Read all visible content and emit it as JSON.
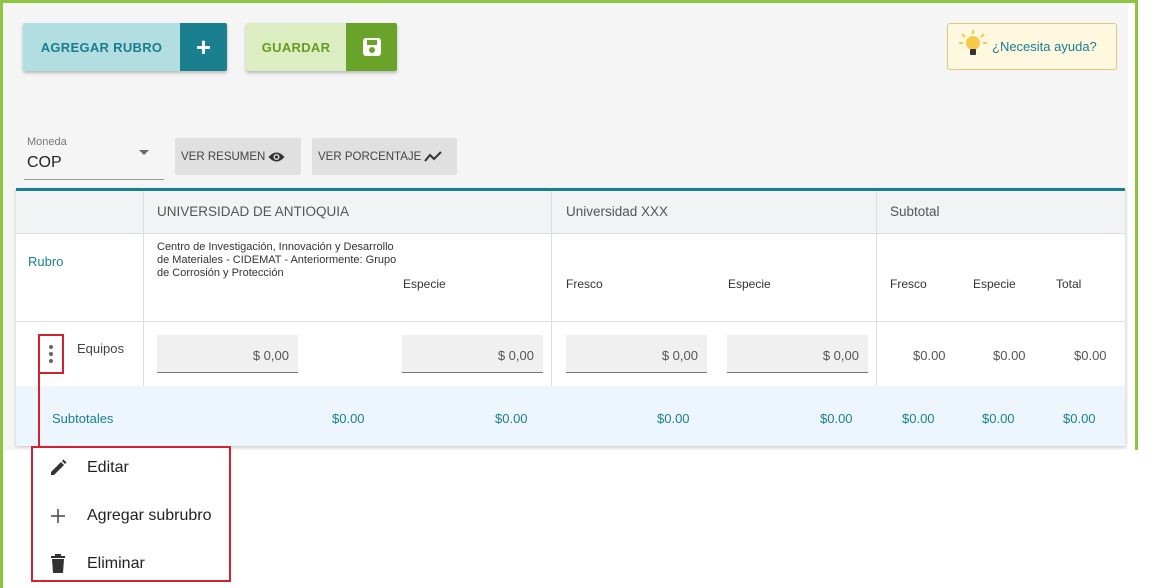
{
  "toolbar": {
    "add_label": "AGREGAR RUBRO",
    "save_label": "GUARDAR",
    "help_label": "¿Necesita ayuda?"
  },
  "filters": {
    "currency_caption": "Moneda",
    "currency_value": "COP",
    "summary_label": "VER RESUMEN",
    "percent_label": "VER PORCENTAJE"
  },
  "table": {
    "groups": [
      "UNIVERSIDAD DE ANTIOQUIA",
      "Universidad XXX",
      "Subtotal"
    ],
    "rubro_header": "Rubro",
    "sub_headers": {
      "g1_col1": "Centro de Investigación, Innovación y Desarrollo de Materiales - CIDEMAT - Anteriormente: Grupo de Corrosión y Protección",
      "g1_col2": "Especie",
      "g2_col1": "Fresco",
      "g2_col2": "Especie",
      "g3_col1": "Fresco",
      "g3_col2": "Especie",
      "g3_col3": "Total"
    },
    "row": {
      "name": "Equipos",
      "inputs": [
        "$ 0,00",
        "$ 0,00",
        "$ 0,00",
        "$ 0,00"
      ],
      "subtotal_fresco": "$0.00",
      "subtotal_especie": "$0.00",
      "subtotal_total": "$0.00"
    },
    "subtotals": {
      "label": "Subtotales",
      "values": [
        "$0.00",
        "$0.00",
        "$0.00",
        "$0.00",
        "$0.00",
        "$0.00",
        "$0.00"
      ]
    }
  },
  "context_menu": {
    "items": [
      "Editar",
      "Agregar subrubro",
      "Eliminar"
    ]
  },
  "colors": {
    "teal": "#1a8090",
    "green": "#6aa32a",
    "highlight_red": "#d42030",
    "frame_green": "#8cc63f"
  },
  "icons": [
    "plus-icon",
    "save-icon",
    "lightbulb-icon",
    "eye-icon",
    "trend-icon",
    "more-vert-icon",
    "pencil-icon",
    "add-icon",
    "trash-icon"
  ]
}
